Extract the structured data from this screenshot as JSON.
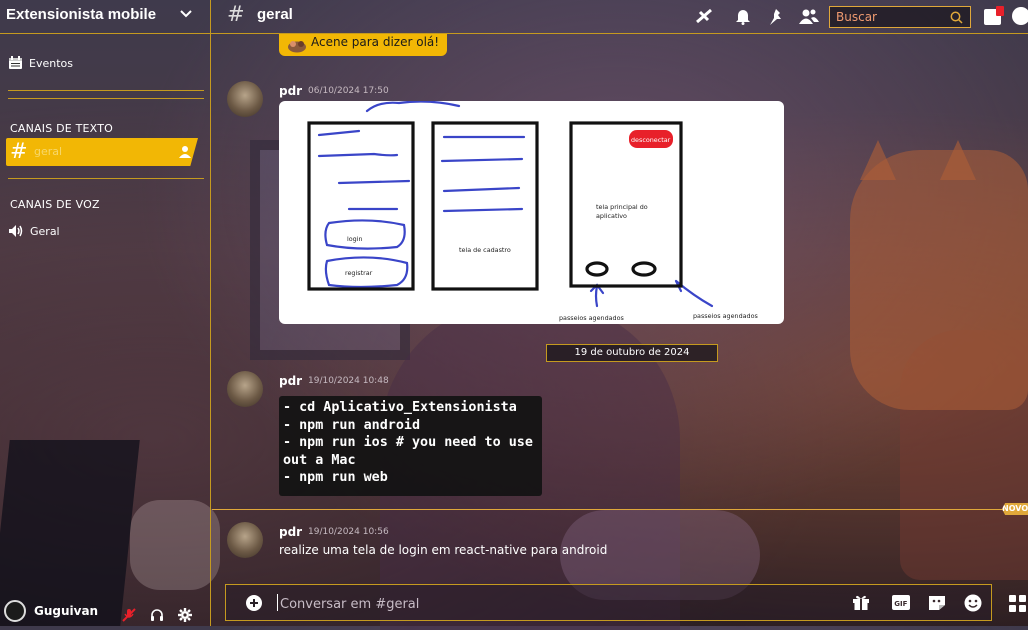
{
  "app": {
    "server_name": "Extensionista mobile",
    "channel_name": "geral"
  },
  "sidebar": {
    "events_label": "Eventos",
    "text_category": "CANAIS DE TEXTO",
    "voice_category": "CANAIS DE VOZ",
    "text_channels": [
      {
        "label": "geral",
        "selected": true
      }
    ],
    "voice_channels": [
      {
        "label": "Geral"
      }
    ]
  },
  "user_panel": {
    "username": "Guguivan"
  },
  "search": {
    "placeholder": "Buscar"
  },
  "chat": {
    "system_message": "Acene para dizer olá!",
    "messages": [
      {
        "author": "pdr",
        "timestamp": "06/10/2024 17:50"
      },
      {
        "author": "pdr",
        "timestamp": "19/10/2024 10:48"
      },
      {
        "author": "pdr",
        "timestamp": "19/10/2024 10:56",
        "text": "realize uma tela de login em react-native para android"
      }
    ],
    "code_text": "- cd Aplicativo_Extensionista\n- npm run android\n- npm run ios # you need to use\nout a Mac\n- npm run web",
    "date_divider": "19 de outubro de 2024",
    "new_badge": "NOVO"
  },
  "sketch": {
    "login": "login",
    "registrar": "registrar",
    "tela_cadastro": "tela de cadastro",
    "desconectar": "desconectar",
    "tela_principal": "tela principal do aplicativo",
    "passeios_1": "passeios agendados",
    "passeios_2": "passeios agendados"
  },
  "composer": {
    "placeholder": "Conversar em #geral"
  },
  "colors": {
    "accent": "#f2b705",
    "border": "#c59a1f",
    "danger": "#e8202a"
  }
}
